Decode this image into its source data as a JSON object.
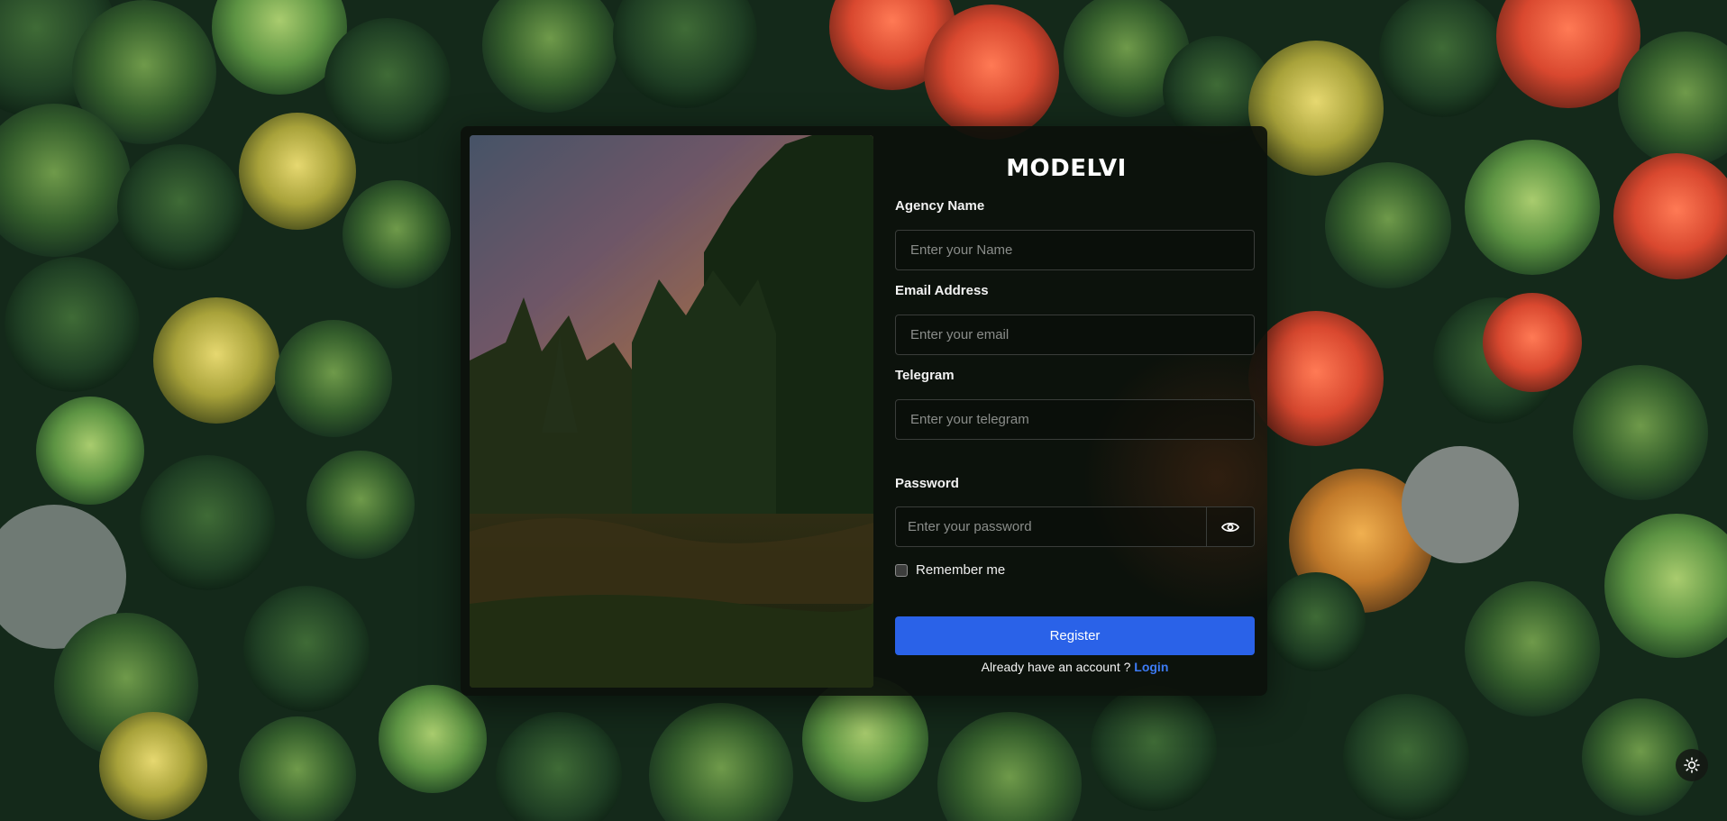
{
  "brand": {
    "name": "MODELVI"
  },
  "form": {
    "agency_name": {
      "label": "Agency Name",
      "placeholder": "Enter your Name",
      "value": ""
    },
    "email": {
      "label": "Email Address",
      "placeholder": "Enter your email",
      "value": ""
    },
    "telegram": {
      "label": "Telegram",
      "placeholder": "Enter your telegram",
      "value": ""
    },
    "password": {
      "label": "Password",
      "placeholder": "Enter your password",
      "value": "",
      "toggle_icon": "eye-icon"
    },
    "remember": {
      "label": "Remember me",
      "checked": false
    },
    "submit_label": "Register",
    "login_prompt": "Already have an account ?",
    "login_link": "Login"
  },
  "theme_toggle": {
    "icon": "sun-icon"
  },
  "colors": {
    "primary": "#2a62e8",
    "link": "#3d7bf5",
    "card_background": "#0c100b"
  }
}
